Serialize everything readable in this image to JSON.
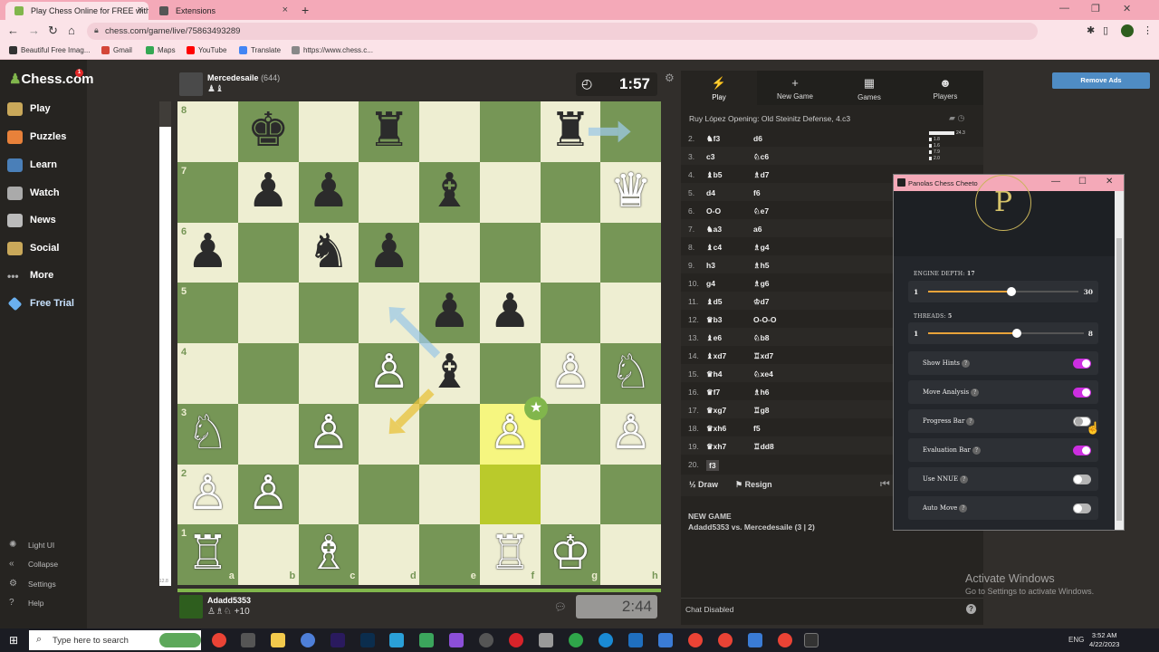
{
  "browser": {
    "tabs": [
      {
        "title": "Play Chess Online for FREE with",
        "active": true
      },
      {
        "title": "Extensions",
        "active": false
      }
    ],
    "url": "chess.com/game/live/75863493289",
    "bookmarks": [
      "Beautiful Free Imag...",
      "Gmail",
      "Maps",
      "YouTube",
      "Translate",
      "https://www.chess.c..."
    ]
  },
  "sidebar": {
    "logo": "Chess.com",
    "badge": "1",
    "items": [
      "Play",
      "Puzzles",
      "Learn",
      "Watch",
      "News",
      "Social",
      "More",
      "Free Trial"
    ],
    "footer": [
      "Light UI",
      "Collapse",
      "Settings",
      "Help"
    ]
  },
  "game": {
    "top_player": {
      "name": "Mercedesaile",
      "rating": "(644)",
      "clock": "1:57"
    },
    "bottom_player": {
      "name": "Adadd5353",
      "material": "+10",
      "clock": "2:44"
    },
    "eval_value": "12.8",
    "ranks": [
      "8",
      "7",
      "6",
      "5",
      "4",
      "3",
      "2",
      "1"
    ],
    "files": [
      "a",
      "b",
      "c",
      "d",
      "e",
      "f",
      "g",
      "h"
    ],
    "pieces": [
      {
        "sq": "b8",
        "glyph": "♚",
        "color": "b"
      },
      {
        "sq": "d8",
        "glyph": "♜",
        "color": "b"
      },
      {
        "sq": "g8",
        "glyph": "♜",
        "color": "b"
      },
      {
        "sq": "b7",
        "glyph": "♟",
        "color": "b"
      },
      {
        "sq": "c7",
        "glyph": "♟",
        "color": "b"
      },
      {
        "sq": "e7",
        "glyph": "♝",
        "color": "b"
      },
      {
        "sq": "h7",
        "glyph": "♛",
        "color": "w"
      },
      {
        "sq": "a6",
        "glyph": "♟",
        "color": "b"
      },
      {
        "sq": "c6",
        "glyph": "♞",
        "color": "b"
      },
      {
        "sq": "d6",
        "glyph": "♟",
        "color": "b"
      },
      {
        "sq": "e5",
        "glyph": "♟",
        "color": "b"
      },
      {
        "sq": "f5",
        "glyph": "♟",
        "color": "b"
      },
      {
        "sq": "d4",
        "glyph": "♙",
        "color": "w"
      },
      {
        "sq": "e4",
        "glyph": "♝",
        "color": "b"
      },
      {
        "sq": "g4",
        "glyph": "♙",
        "color": "w"
      },
      {
        "sq": "h4",
        "glyph": "♘",
        "color": "w"
      },
      {
        "sq": "a3",
        "glyph": "♘",
        "color": "w"
      },
      {
        "sq": "c3",
        "glyph": "♙",
        "color": "w"
      },
      {
        "sq": "f3",
        "glyph": "♙",
        "color": "w"
      },
      {
        "sq": "h3",
        "glyph": "♙",
        "color": "w"
      },
      {
        "sq": "a2",
        "glyph": "♙",
        "color": "w"
      },
      {
        "sq": "b2",
        "glyph": "♙",
        "color": "w"
      },
      {
        "sq": "a1",
        "glyph": "♖",
        "color": "w"
      },
      {
        "sq": "c1",
        "glyph": "♗",
        "color": "w"
      },
      {
        "sq": "f1",
        "glyph": "♖",
        "color": "w"
      },
      {
        "sq": "g1",
        "glyph": "♔",
        "color": "w"
      }
    ],
    "highlight": [
      "f2",
      "f3"
    ]
  },
  "panel": {
    "tabs": [
      {
        "label": "Play",
        "icon": "⚡"
      },
      {
        "label": "New Game",
        "icon": "+"
      },
      {
        "label": "Games",
        "icon": "▦"
      },
      {
        "label": "Players",
        "icon": "☻"
      }
    ],
    "opening": "Ruy López Opening: Old Steinitz Defense, 4.c3",
    "moves": [
      {
        "n": "2.",
        "w": "♞f3",
        "b": "d6"
      },
      {
        "n": "3.",
        "w": "c3",
        "b": "♘c6"
      },
      {
        "n": "4.",
        "w": "♝b5",
        "b": "♗d7"
      },
      {
        "n": "5.",
        "w": "d4",
        "b": "f6"
      },
      {
        "n": "6.",
        "w": "O-O",
        "b": "♘e7"
      },
      {
        "n": "7.",
        "w": "♞a3",
        "b": "a6"
      },
      {
        "n": "8.",
        "w": "♝c4",
        "b": "♗g4"
      },
      {
        "n": "9.",
        "w": "h3",
        "b": "♗h5"
      },
      {
        "n": "10.",
        "w": "g4",
        "b": "♗g6"
      },
      {
        "n": "11.",
        "w": "♝d5",
        "b": "♔d7"
      },
      {
        "n": "12.",
        "w": "♛b3",
        "b": "O-O-O"
      },
      {
        "n": "13.",
        "w": "♝e6",
        "b": "♘b8"
      },
      {
        "n": "14.",
        "w": "♝xd7",
        "b": "♖xd7"
      },
      {
        "n": "15.",
        "w": "♛h4",
        "b": "♘xe4"
      },
      {
        "n": "16.",
        "w": "♛f7",
        "b": "♗h6"
      },
      {
        "n": "17.",
        "w": "♛xg7",
        "b": "♖g8"
      },
      {
        "n": "18.",
        "w": "♛xh6",
        "b": "f5"
      },
      {
        "n": "19.",
        "w": "♛xh7",
        "b": "♖dd8"
      },
      {
        "n": "20.",
        "w": "f3",
        "b": ""
      }
    ],
    "evals": [
      "24.3",
      "1.8",
      "1.6",
      "7.9",
      "2.0"
    ],
    "draw": "Draw",
    "resign": "Resign",
    "new_game_title": "NEW GAME",
    "new_game_info": "Adadd5353 vs. Mercedesaile (3 | 2)",
    "chat": "Chat Disabled"
  },
  "remove_ads": "Remove Ads",
  "extension": {
    "title": "Panolas Chess Cheeto",
    "logo": "P",
    "depth_label": "ENGINE DEPTH:",
    "depth_value": "17",
    "depth": {
      "min": "1",
      "max": "30",
      "value": 17
    },
    "threads_label": "THREADS:",
    "threads_value": "5",
    "threads": {
      "min": "1",
      "max": "8",
      "value": 5
    },
    "toggles": [
      {
        "label": "Show Hints",
        "state": "on"
      },
      {
        "label": "Move Analysis",
        "state": "on"
      },
      {
        "label": "Progress Bar",
        "state": "hover"
      },
      {
        "label": "Evaluation Bar",
        "state": "on"
      },
      {
        "label": "Use NNUE",
        "state": "off"
      },
      {
        "label": "Auto Move",
        "state": "off"
      }
    ],
    "accent_color": "#cc2ee0",
    "slider_color": "#e8a33a"
  },
  "windows": {
    "activate_title": "Activate Windows",
    "activate_sub": "Go to Settings to activate Windows.",
    "search_placeholder": "Type here to search",
    "lang": "ENG",
    "time": "3:52 AM",
    "date": "4/22/2023"
  }
}
